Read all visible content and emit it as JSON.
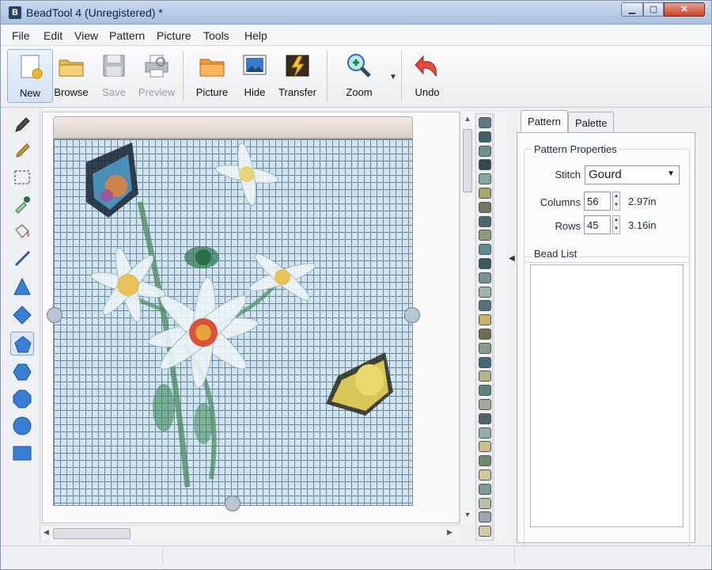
{
  "window": {
    "title": "BeadTool 4 (Unregistered) *"
  },
  "menu": [
    "File",
    "Edit",
    "View",
    "Pattern",
    "Picture",
    "Tools",
    "Help"
  ],
  "toolbar": {
    "new": "New",
    "browse": "Browse",
    "save": "Save",
    "preview": "Preview",
    "picture": "Picture",
    "hide": "Hide",
    "transfer": "Transfer",
    "zoom": "Zoom",
    "undo": "Undo"
  },
  "tools": [
    "pencil-icon",
    "thin-pencil-icon",
    "select-rect-icon",
    "eyedropper-icon",
    "fill-bucket-icon",
    "line-icon",
    "triangle-icon",
    "diamond-icon",
    "pentagon-icon",
    "hexagon-icon",
    "octagon-icon",
    "circle-icon",
    "rectangle-icon"
  ],
  "beads": [
    "#5b7a82",
    "#3f5f6a",
    "#6f8f8a",
    "#2f4a55",
    "#7fa89f",
    "#a6a86b",
    "#6a7a60",
    "#4a6a6e",
    "#8a9b7c",
    "#5f8a8f",
    "#3b5860",
    "#7a8f95",
    "#9fb5a8",
    "#54707a",
    "#c9b26a",
    "#6d6e4f",
    "#879c84",
    "#3e6a74",
    "#b4b58a",
    "#5e7f7c",
    "#a0a89a",
    "#4c6470",
    "#8fb0a5",
    "#c7c08a",
    "#6e8a6e",
    "#d0c69a",
    "#7e9a98",
    "#b9bfa3",
    "#9aa5b0",
    "#cfc8a8"
  ],
  "panel": {
    "tabs": [
      "Pattern",
      "Palette"
    ],
    "properties_title": "Pattern Properties",
    "stitch_label": "Stitch",
    "stitch_value": "Gourd",
    "columns_label": "Columns",
    "columns_value": "56",
    "columns_inches": "2.97in",
    "rows_label": "Rows",
    "rows_value": "45",
    "rows_inches": "3.16in",
    "bead_list_title": "Bead List"
  }
}
